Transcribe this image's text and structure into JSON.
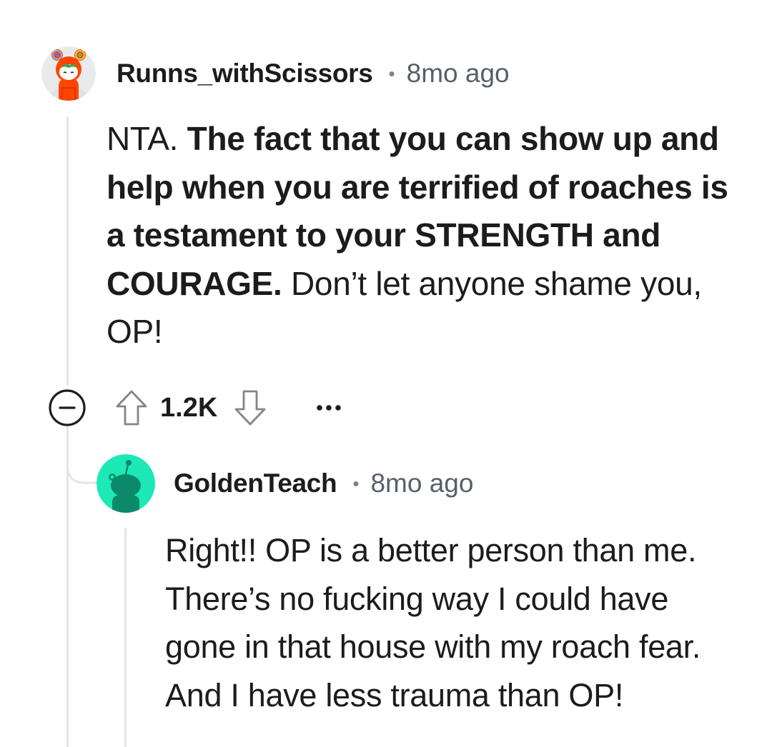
{
  "colors": {
    "accent_avatar_bg": "#1de9b6",
    "thread_line": "#e3e5e8",
    "muted_text": "#576069",
    "avatar1_hood": "#ff4500"
  },
  "comments": [
    {
      "username": "Runns_withScissors",
      "separator": "•",
      "timestamp": "8mo ago",
      "body": [
        {
          "text": "NTA. ",
          "bold": false
        },
        {
          "text": "The fact that you can show up and help when you are terrified of roaches is a testament to your STRENGTH and COURAGE.",
          "bold": true
        },
        {
          "text": " Don’t let anyone shame you, OP!",
          "bold": false
        }
      ],
      "actions": {
        "collapse_icon": "minus-circle-icon",
        "upvote_icon": "arrow-up-icon",
        "score": "1.2K",
        "downvote_icon": "arrow-down-icon",
        "more_icon": "more-horizontal-icon"
      }
    },
    {
      "username": "GoldenTeach",
      "separator": "•",
      "timestamp": "8mo ago",
      "body": [
        {
          "text": "Right!! OP is a better person than me. There’s no fucking way I could have gone in that house with my roach fear. And I have less trauma than OP!",
          "bold": false
        }
      ]
    }
  ]
}
